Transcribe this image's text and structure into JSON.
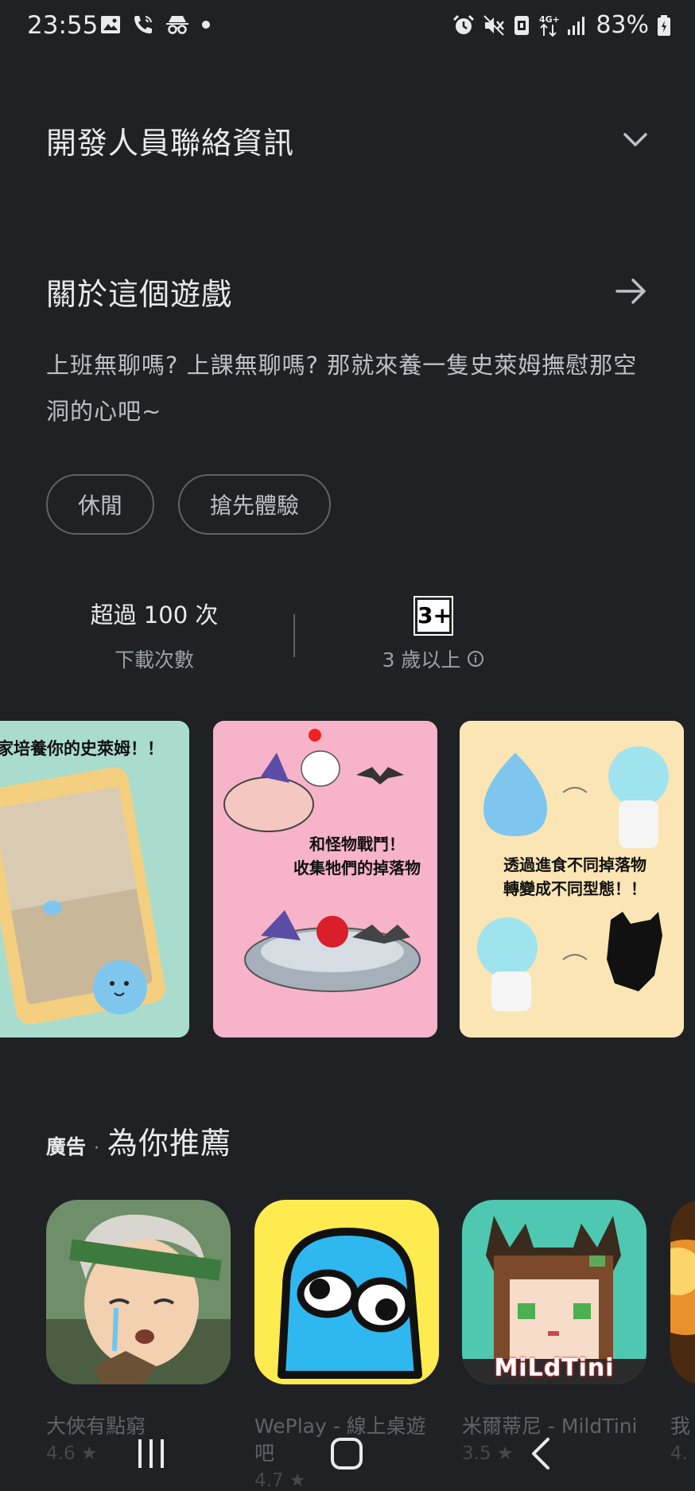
{
  "status_bar": {
    "time": "23:55",
    "battery_percent": "83%",
    "icons_left": [
      "image-icon",
      "wifi-call-icon",
      "incognito-icon",
      "dot-icon"
    ],
    "icons_right": [
      "alarm-icon",
      "mute-icon",
      "nfc-icon",
      "4g-icon",
      "signal-icon",
      "battery-icon"
    ]
  },
  "developer_contact": {
    "title": "開發人員聯絡資訊",
    "icon": "chevron-down-icon"
  },
  "about": {
    "title": "關於這個遊戲",
    "icon": "arrow-right-icon",
    "description": "上班無聊嗎? 上課無聊嗎? 那就來養一隻史萊姆撫慰那空洞的心吧~"
  },
  "tags": [
    "休閒",
    "搶先體驗"
  ],
  "stats": {
    "downloads_value": "超過 100 次",
    "downloads_label": "下載次數",
    "content_rating_badge": "3+",
    "content_rating_label": "3 歲以上"
  },
  "screenshots": [
    {
      "caption": "家培養你的史萊姆！！"
    },
    {
      "caption": "和怪物戰鬥！\n收集牠們的掉落物"
    },
    {
      "caption": "透過進食不同掉落物\n轉變成不同型態！！"
    }
  ],
  "ads": {
    "label": "廣告",
    "separator": "·",
    "title": "為你推薦",
    "apps": [
      {
        "name": "大俠有點窮",
        "rating": "4.6 ★"
      },
      {
        "name": "WePlay - 線上桌遊吧",
        "rating": "4.7 ★"
      },
      {
        "name": "米爾蒂尼 - MildTini",
        "rating": "3.5 ★",
        "icon_text": "MiLdTini"
      },
      {
        "name": "我",
        "rating": "4."
      }
    ]
  },
  "colors": {
    "background": "#202124",
    "text_primary": "#e8eaed",
    "text_secondary": "#bdc1c6",
    "chip_border": "#5f6368"
  }
}
